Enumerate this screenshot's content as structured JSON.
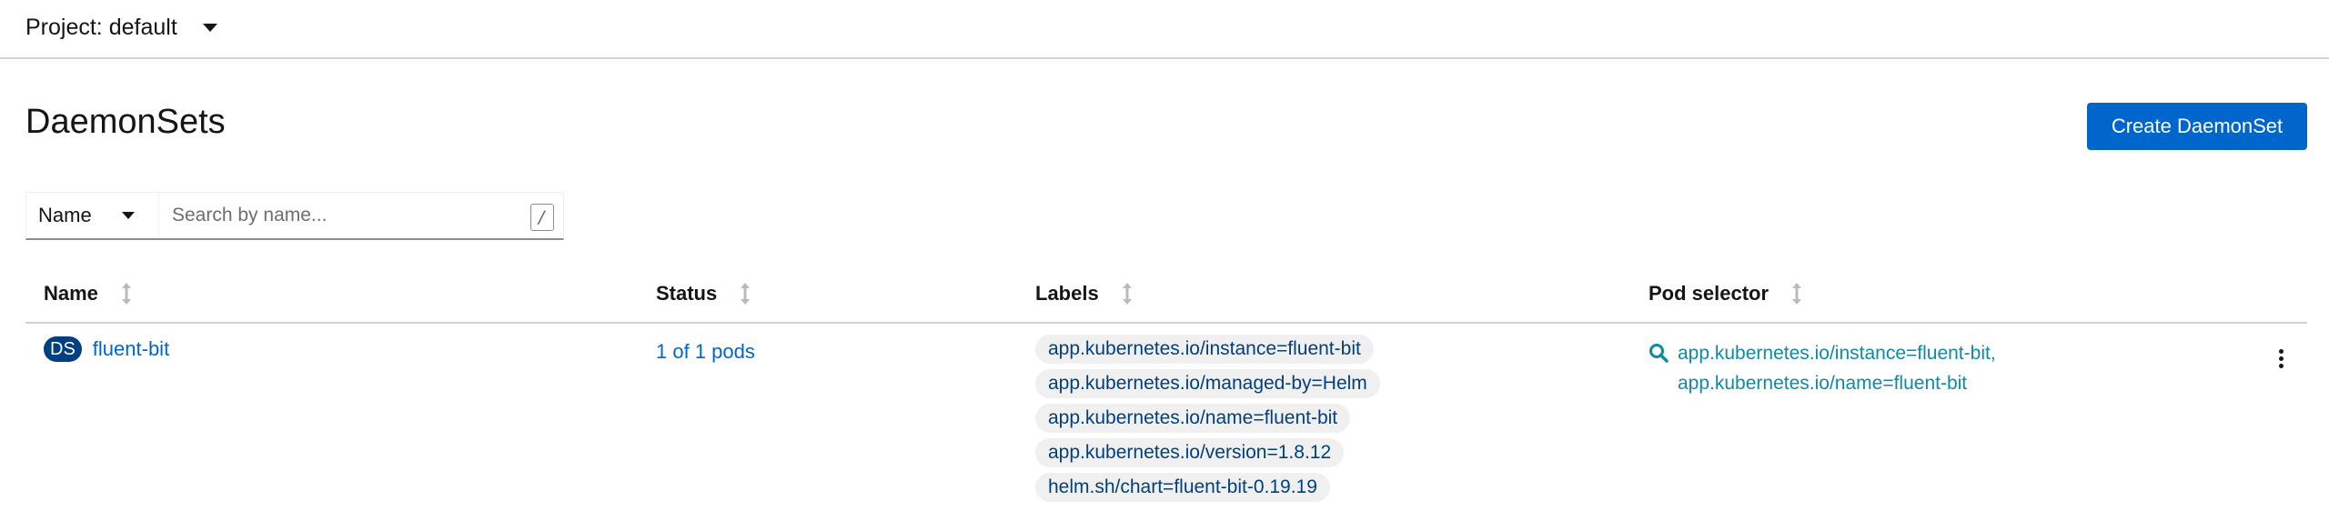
{
  "project": {
    "label": "Project: default"
  },
  "page": {
    "title": "DaemonSets",
    "create_label": "Create DaemonSet"
  },
  "filter": {
    "selected": "Name",
    "placeholder": "Search by name...",
    "shortcut": "/"
  },
  "table": {
    "columns": [
      "Name",
      "Status",
      "Labels",
      "Pod selector"
    ],
    "rows": [
      {
        "badge": "DS",
        "name": "fluent-bit",
        "status": "1 of 1 pods",
        "labels": [
          "app.kubernetes.io/instance=fluent-bit",
          "app.kubernetes.io/managed-by=Helm",
          "app.kubernetes.io/name=fluent-bit",
          "app.kubernetes.io/version=1.8.12",
          "helm.sh/chart=fluent-bit-0.19.19"
        ],
        "selector": [
          "app.kubernetes.io/instance=fluent-bit,",
          "app.kubernetes.io/name=fluent-bit"
        ]
      }
    ]
  },
  "icons": {
    "project_caret": "caret-down-icon",
    "filter_caret": "caret-down-icon",
    "sort": "sort-icon",
    "selector": "search-icon",
    "row_menu": "kebab-icon"
  },
  "colors": {
    "primary": "#0066cc",
    "badge": "#004080",
    "selector_link": "#0f8aa6",
    "chip_bg": "#f0f0f0"
  }
}
